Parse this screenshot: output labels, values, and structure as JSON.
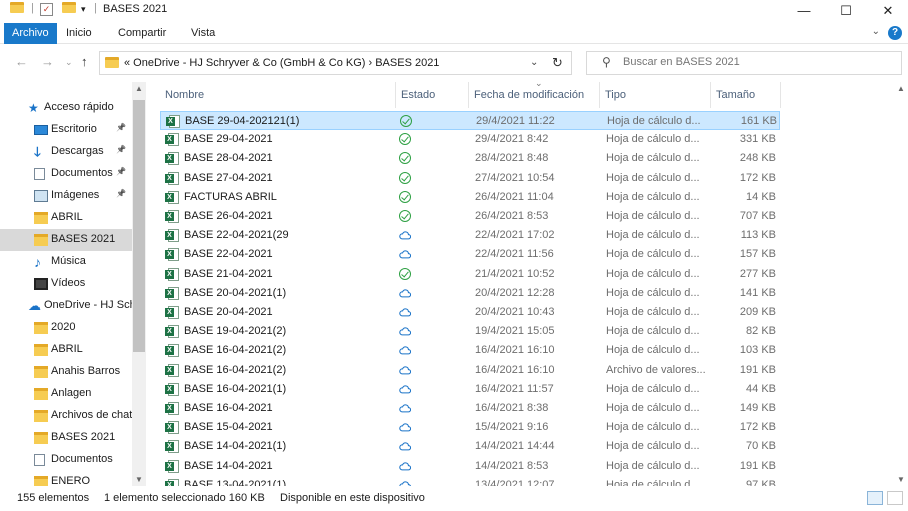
{
  "window": {
    "title": "BASES 2021",
    "controls": {
      "minimize": "—",
      "maximize": "☐",
      "close": "✕"
    }
  },
  "ribbon": {
    "tabs": [
      "Archivo",
      "Inicio",
      "Compartir",
      "Vista"
    ],
    "active_tab": "Archivo",
    "help": "?"
  },
  "address": {
    "path_text": "«  OneDrive - HJ Schryver & Co (GmbH & Co KG)  ›  BASES 2021",
    "search_placeholder": "Buscar en BASES 2021"
  },
  "nav_pane": {
    "items": [
      {
        "label": "Acceso rápido",
        "icon": "star-icon",
        "indent": 0,
        "pinned": false
      },
      {
        "label": "Escritorio",
        "icon": "desktop-icon",
        "indent": 1,
        "pinned": true
      },
      {
        "label": "Descargas",
        "icon": "download-icon",
        "indent": 1,
        "pinned": true
      },
      {
        "label": "Documentos",
        "icon": "document-icon",
        "indent": 1,
        "pinned": true
      },
      {
        "label": "Imágenes",
        "icon": "image-icon",
        "indent": 1,
        "pinned": true
      },
      {
        "label": "ABRIL",
        "icon": "folder-icon",
        "indent": 1,
        "pinned": false
      },
      {
        "label": "BASES 2021",
        "icon": "folder-icon",
        "indent": 1,
        "pinned": false,
        "selected": true
      },
      {
        "label": "Música",
        "icon": "music-icon",
        "indent": 1,
        "pinned": false
      },
      {
        "label": "Vídeos",
        "icon": "video-icon",
        "indent": 1,
        "pinned": false
      },
      {
        "label": "OneDrive - HJ Sch",
        "icon": "cloud-icon",
        "indent": 0,
        "pinned": false
      },
      {
        "label": "2020",
        "icon": "folder-icon",
        "indent": 1,
        "pinned": false
      },
      {
        "label": "ABRIL",
        "icon": "folder-icon",
        "indent": 1,
        "pinned": false
      },
      {
        "label": "Anahis Barros",
        "icon": "folder-icon",
        "indent": 1,
        "pinned": false
      },
      {
        "label": "Anlagen",
        "icon": "folder-icon",
        "indent": 1,
        "pinned": false
      },
      {
        "label": "Archivos de chat",
        "icon": "folder-icon",
        "indent": 1,
        "pinned": false
      },
      {
        "label": "BASES 2021",
        "icon": "folder-icon",
        "indent": 1,
        "pinned": false
      },
      {
        "label": "Documentos",
        "icon": "document-icon",
        "indent": 1,
        "pinned": false
      },
      {
        "label": "ENERO",
        "icon": "folder-icon",
        "indent": 1,
        "pinned": false
      }
    ]
  },
  "columns": {
    "name": "Nombre",
    "status": "Estado",
    "modified": "Fecha de modificación",
    "type": "Tipo",
    "size": "Tamaño"
  },
  "files": [
    {
      "name": "BASE 29-04-202121(1)",
      "status": "ok",
      "modified": "29/4/2021 11:22",
      "type": "Hoja de cálculo d...",
      "size": "161 KB",
      "selected": true
    },
    {
      "name": "BASE 29-04-2021",
      "status": "ok",
      "modified": "29/4/2021 8:42",
      "type": "Hoja de cálculo d...",
      "size": "331 KB"
    },
    {
      "name": "BASE 28-04-2021",
      "status": "ok",
      "modified": "28/4/2021 8:48",
      "type": "Hoja de cálculo d...",
      "size": "248 KB"
    },
    {
      "name": "BASE 27-04-2021",
      "status": "ok",
      "modified": "27/4/2021 10:54",
      "type": "Hoja de cálculo d...",
      "size": "172 KB"
    },
    {
      "name": "FACTURAS ABRIL",
      "status": "ok",
      "modified": "26/4/2021 11:04",
      "type": "Hoja de cálculo d...",
      "size": "14 KB"
    },
    {
      "name": "BASE 26-04-2021",
      "status": "ok",
      "modified": "26/4/2021 8:53",
      "type": "Hoja de cálculo d...",
      "size": "707 KB"
    },
    {
      "name": "BASE 22-04-2021(29",
      "status": "cloud",
      "modified": "22/4/2021 17:02",
      "type": "Hoja de cálculo d...",
      "size": "113 KB"
    },
    {
      "name": "BASE 22-04-2021",
      "status": "cloud",
      "modified": "22/4/2021 11:56",
      "type": "Hoja de cálculo d...",
      "size": "157 KB"
    },
    {
      "name": "BASE 21-04-2021",
      "status": "ok",
      "modified": "21/4/2021 10:52",
      "type": "Hoja de cálculo d...",
      "size": "277 KB"
    },
    {
      "name": "BASE 20-04-2021(1)",
      "status": "cloud",
      "modified": "20/4/2021 12:28",
      "type": "Hoja de cálculo d...",
      "size": "141 KB"
    },
    {
      "name": "BASE 20-04-2021",
      "status": "cloud",
      "modified": "20/4/2021 10:43",
      "type": "Hoja de cálculo d...",
      "size": "209 KB"
    },
    {
      "name": "BASE 19-04-2021(2)",
      "status": "cloud",
      "modified": "19/4/2021 15:05",
      "type": "Hoja de cálculo d...",
      "size": "82 KB"
    },
    {
      "name": "BASE 16-04-2021(2)",
      "status": "cloud",
      "modified": "16/4/2021 16:10",
      "type": "Hoja de cálculo d...",
      "size": "103 KB"
    },
    {
      "name": "BASE 16-04-2021(2)",
      "status": "cloud",
      "modified": "16/4/2021 16:10",
      "type": "Archivo de valores...",
      "size": "191 KB"
    },
    {
      "name": "BASE 16-04-2021(1)",
      "status": "cloud",
      "modified": "16/4/2021 11:57",
      "type": "Hoja de cálculo d...",
      "size": "44 KB"
    },
    {
      "name": "BASE 16-04-2021",
      "status": "cloud",
      "modified": "16/4/2021 8:38",
      "type": "Hoja de cálculo d...",
      "size": "149 KB"
    },
    {
      "name": "BASE 15-04-2021",
      "status": "cloud",
      "modified": "15/4/2021 9:16",
      "type": "Hoja de cálculo d...",
      "size": "172 KB"
    },
    {
      "name": "BASE 14-04-2021(1)",
      "status": "cloud",
      "modified": "14/4/2021 14:44",
      "type": "Hoja de cálculo d...",
      "size": "70 KB"
    },
    {
      "name": "BASE 14-04-2021",
      "status": "cloud",
      "modified": "14/4/2021 8:53",
      "type": "Hoja de cálculo d...",
      "size": "191 KB"
    },
    {
      "name": "BASE 13-04-2021(1)",
      "status": "cloud",
      "modified": "13/4/2021 12:07",
      "type": "Hoja de cálculo d...",
      "size": "97 KB"
    }
  ],
  "statusbar": {
    "count": "155 elementos",
    "selection": "1 elemento seleccionado  160 KB",
    "availability": "Disponible en este dispositivo"
  },
  "colors": {
    "accent": "#1979ca",
    "selected_row": "#cce8ff",
    "synced_green": "#2ea043",
    "cloud_blue": "#1a73c8",
    "excel_green": "#1d7245"
  }
}
